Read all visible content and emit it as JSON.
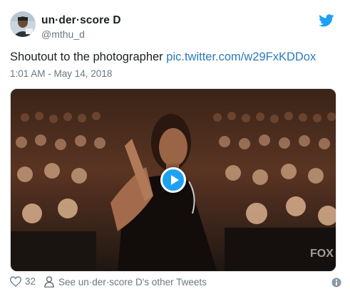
{
  "user": {
    "display_name": "un·der·score D",
    "handle": "@mthu_d"
  },
  "tweet": {
    "text": "Shoutout to the photographer ",
    "link_text": "pic.twitter.com/w29FxKDDox",
    "timestamp": "1:01 AM - May 14, 2018"
  },
  "media": {
    "type": "gif",
    "overlay_text": "FOX"
  },
  "footer": {
    "likes_count": "32",
    "other_tweets_label": "See un·der·score D's other Tweets"
  },
  "icons": {
    "brand": "twitter-bird-icon",
    "like": "heart-icon",
    "profile": "person-icon",
    "info": "info-icon"
  },
  "colors": {
    "brand_blue": "#1da1f2",
    "link": "#2b7bb9",
    "muted": "#697882",
    "text": "#1c2022"
  }
}
